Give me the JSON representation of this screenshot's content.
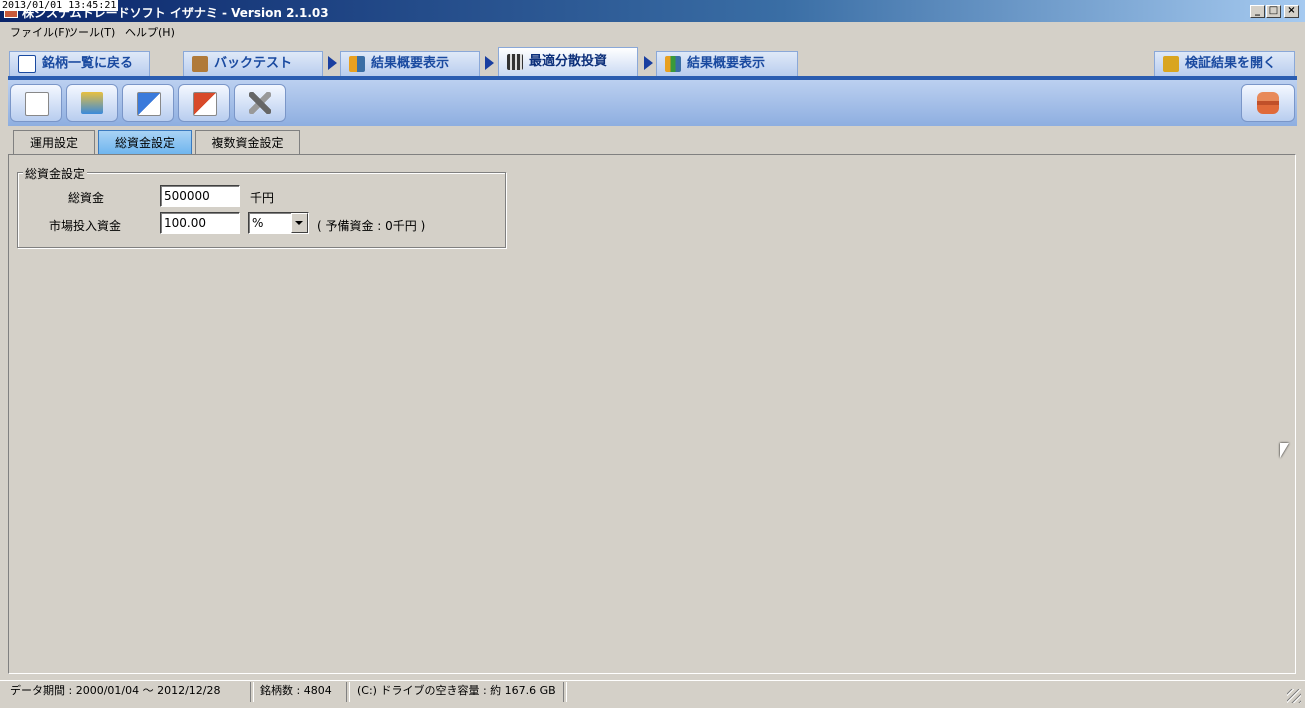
{
  "window": {
    "timestamp": "2013/01/01 13:45:21",
    "title": "株システムトレードソフト イザナミ - Version 2.1.03",
    "controls": [
      "_",
      "□",
      "×"
    ]
  },
  "menu": [
    "ファイル(F)",
    "ツール(T)",
    "ヘルプ(H)"
  ],
  "nav_tabs": [
    {
      "label": "銘柄一覧に戻る",
      "icon": "eye-icon"
    },
    {
      "label": "バックテスト",
      "icon": "money-bag-icon"
    },
    {
      "label": "結果概要表示",
      "icon": "chart-person-icon"
    },
    {
      "label": "最適分散投資",
      "icon": "calculator-icon",
      "active": true
    },
    {
      "label": "結果概要表示",
      "icon": "bar-chart-icon"
    }
  ],
  "open_results_label": "検証結果を開く",
  "toolbar": {
    "buttons": [
      "new-document",
      "fund-settings",
      "export",
      "import",
      "tools"
    ],
    "right_button": "stamp"
  },
  "sub_tabs": [
    {
      "label": "運用設定"
    },
    {
      "label": "総資金設定",
      "active": true
    },
    {
      "label": "複数資金設定"
    }
  ],
  "fund_settings": {
    "group_title": "総資金設定",
    "total_label": "総資金",
    "total_value": "500000",
    "total_unit": "千円",
    "market_label": "市場投入資金",
    "market_value": "100.00",
    "market_unit_selected": "%",
    "reserve_note": "( 予備資金 : 0千円 )"
  },
  "status": {
    "period": "データ期間 : 2000/01/04 〜 2012/12/28",
    "count": "銘柄数 : 4804",
    "drive": "(C:) ドライブの空き容量 : 約 167.6 GB"
  },
  "colors": {
    "accent": "#2a5cb0",
    "tab_text": "#1a4aa0",
    "subtab_active": "#6fb5ee"
  }
}
